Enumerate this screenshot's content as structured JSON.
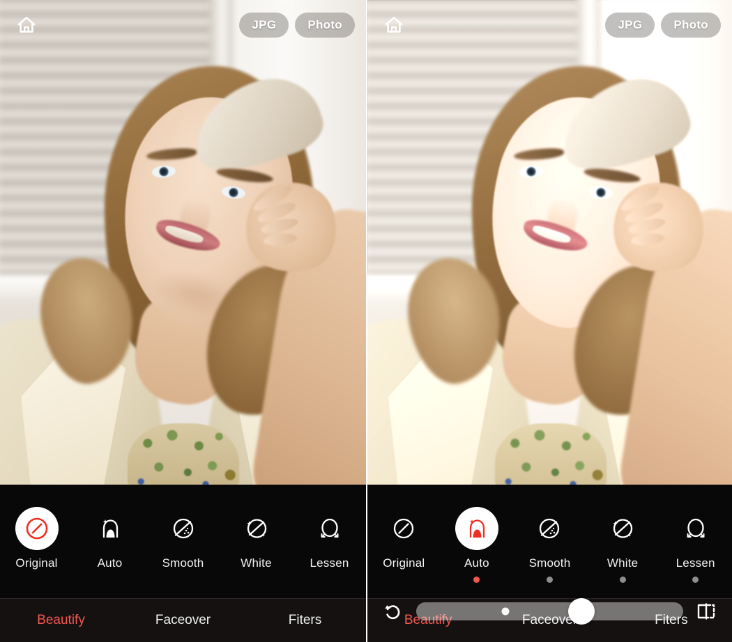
{
  "app": {
    "accent_red": "#f4574f",
    "toolbar_bg": "#080808",
    "pill_bg": "rgba(120,115,110,0.45)"
  },
  "panels": [
    {
      "id": "before",
      "topbar": {
        "home_icon": "home-icon",
        "format_pill": "JPG",
        "mode_pill": "Photo"
      },
      "slider_visible": false,
      "slider": {
        "reset_icon": "reset-arrow-icon",
        "compare_icon": "compare-before-after-icon",
        "value_percent": 0
      },
      "tools": [
        {
          "label": "Original",
          "icon": "no-effect-circle-slash-icon",
          "active": true,
          "dot": "none"
        },
        {
          "label": "Auto",
          "icon": "auto-beautify-face-sparkle-icon",
          "active": false,
          "dot": "none"
        },
        {
          "label": "Smooth",
          "icon": "smooth-skin-circle-dots-icon",
          "active": false,
          "dot": "none"
        },
        {
          "label": "White",
          "icon": "whiten-circle-sparkle-icon",
          "active": false,
          "dot": "none"
        },
        {
          "label": "Lessen",
          "icon": "slim-face-oval-arrows-icon",
          "active": false,
          "dot": "none"
        }
      ],
      "tabs": [
        {
          "label": "Beautify",
          "selected": true
        },
        {
          "label": "Faceover",
          "selected": false
        },
        {
          "label": "Fiters",
          "selected": false
        }
      ]
    },
    {
      "id": "after",
      "topbar": {
        "home_icon": "home-icon",
        "format_pill": "JPG",
        "mode_pill": "Photo"
      },
      "slider_visible": true,
      "slider": {
        "reset_icon": "reset-arrow-icon",
        "compare_icon": "compare-before-after-icon",
        "value_percent": 62
      },
      "tools": [
        {
          "label": "Original",
          "icon": "no-effect-circle-slash-icon",
          "active": false,
          "dot": "none"
        },
        {
          "label": "Auto",
          "icon": "auto-beautify-face-sparkle-icon",
          "active": true,
          "dot": "on"
        },
        {
          "label": "Smooth",
          "icon": "smooth-skin-circle-dots-icon",
          "active": false,
          "dot": "off"
        },
        {
          "label": "White",
          "icon": "whiten-circle-sparkle-icon",
          "active": false,
          "dot": "off"
        },
        {
          "label": "Lessen",
          "icon": "slim-face-oval-arrows-icon",
          "active": false,
          "dot": "off"
        }
      ],
      "tabs": [
        {
          "label": "Beautify",
          "selected": true
        },
        {
          "label": "Faceover",
          "selected": false
        },
        {
          "label": "Fiters",
          "selected": false
        }
      ]
    }
  ]
}
